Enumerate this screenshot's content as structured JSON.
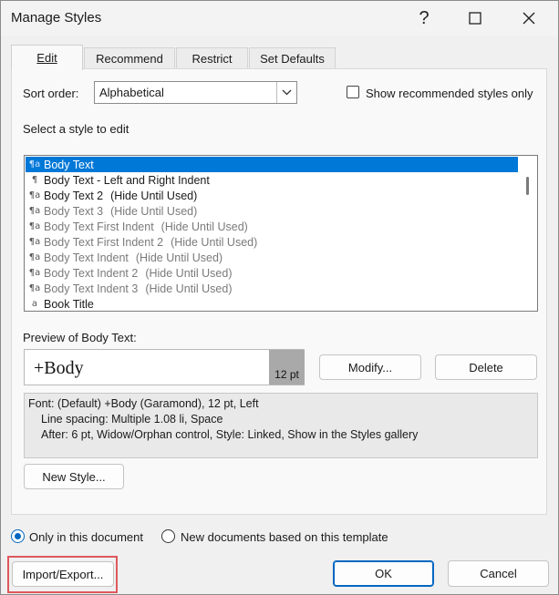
{
  "window": {
    "title": "Manage Styles",
    "help_glyph": "?",
    "maximize_glyph": "☐",
    "close_glyph": "✕"
  },
  "tabs": [
    {
      "label": "Edit",
      "active": true
    },
    {
      "label": "Recommend",
      "active": false
    },
    {
      "label": "Restrict",
      "active": false
    },
    {
      "label": "Set Defaults",
      "active": false
    }
  ],
  "sort": {
    "label": "Sort order:",
    "value": "Alphabetical"
  },
  "show_recommended": {
    "label": "Show recommended styles only",
    "checked": false
  },
  "select_label": "Select a style to edit",
  "styles": [
    {
      "icon": "¶a",
      "name": "Body Text",
      "suffix": "",
      "selected": true,
      "hidden": false
    },
    {
      "icon": "¶",
      "name": "Body Text - Left and Right Indent",
      "suffix": "",
      "selected": false,
      "hidden": false
    },
    {
      "icon": "¶a",
      "name": "Body Text 2",
      "suffix": "(Hide Until Used)",
      "selected": false,
      "hidden": false
    },
    {
      "icon": "¶a",
      "name": "Body Text 3",
      "suffix": "(Hide Until Used)",
      "selected": false,
      "hidden": true
    },
    {
      "icon": "¶a",
      "name": "Body Text First Indent",
      "suffix": "(Hide Until Used)",
      "selected": false,
      "hidden": true
    },
    {
      "icon": "¶a",
      "name": "Body Text First Indent 2",
      "suffix": "(Hide Until Used)",
      "selected": false,
      "hidden": true
    },
    {
      "icon": "¶a",
      "name": "Body Text Indent",
      "suffix": "(Hide Until Used)",
      "selected": false,
      "hidden": true
    },
    {
      "icon": "¶a",
      "name": "Body Text Indent 2",
      "suffix": "(Hide Until Used)",
      "selected": false,
      "hidden": true
    },
    {
      "icon": "¶a",
      "name": "Body Text Indent 3",
      "suffix": "(Hide Until Used)",
      "selected": false,
      "hidden": true
    },
    {
      "icon": "a",
      "name": "Book Title",
      "suffix": "",
      "selected": false,
      "hidden": false
    }
  ],
  "preview": {
    "label": "Preview of Body Text:",
    "text": "+Body",
    "size": "12 pt"
  },
  "buttons": {
    "modify": "Modify...",
    "delete": "Delete",
    "new_style": "New Style...",
    "import_export": "Import/Export...",
    "ok": "OK",
    "cancel": "Cancel"
  },
  "description": {
    "line1": "Font: (Default) +Body (Garamond), 12 pt, Left",
    "line2": "Line spacing:  Multiple 1.08 li, Space",
    "line3": "After:  6 pt, Widow/Orphan control, Style: Linked, Show in the Styles gallery"
  },
  "scope": {
    "option1": "Only in this document",
    "option2": "New documents based on this template",
    "selected": "option1"
  },
  "colors": {
    "accent": "#0078d7",
    "highlight_border": "#e0585b"
  }
}
